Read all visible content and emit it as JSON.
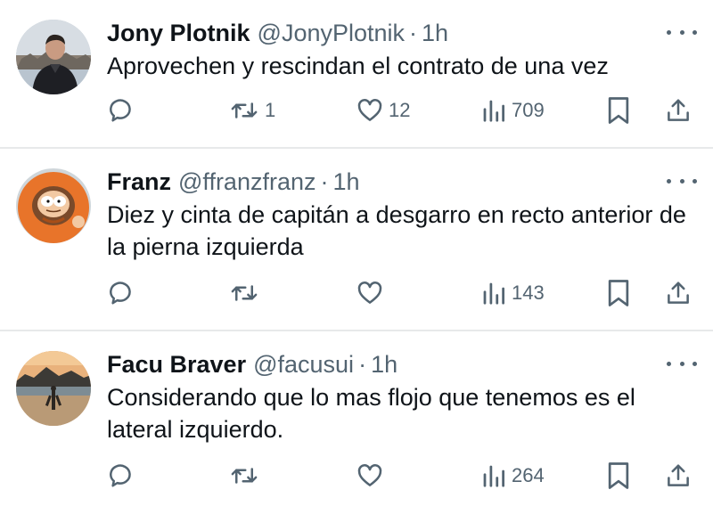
{
  "tweets": [
    {
      "name": "Jony Plotnik",
      "handle": "@JonyPlotnik",
      "separator": "·",
      "time": "1h",
      "text": "Aprovechen y rescindan el contrato de una vez",
      "retweets": "1",
      "likes": "12",
      "views": "709"
    },
    {
      "name": "Franz",
      "handle": "@ffranzfranz",
      "separator": "·",
      "time": "1h",
      "text": "Diez y cinta de capitán a desgarro en recto anterior de la pierna izquierda",
      "retweets": "",
      "likes": "",
      "views": "143"
    },
    {
      "name": "Facu Braver",
      "handle": "@facusui",
      "separator": "·",
      "time": "1h",
      "text": "Considerando que lo mas flojo que tenemos es el lateral izquierdo.",
      "retweets": "",
      "likes": "",
      "views": "264"
    }
  ],
  "icons": {
    "reply": "reply-icon",
    "retweet": "retweet-icon",
    "like": "heart-icon",
    "views": "views-icon",
    "bookmark": "bookmark-icon",
    "share": "share-icon",
    "more": "more-icon"
  },
  "colors": {
    "text": "#0f1419",
    "secondary": "#536471",
    "divider": "#e7e9ea"
  }
}
